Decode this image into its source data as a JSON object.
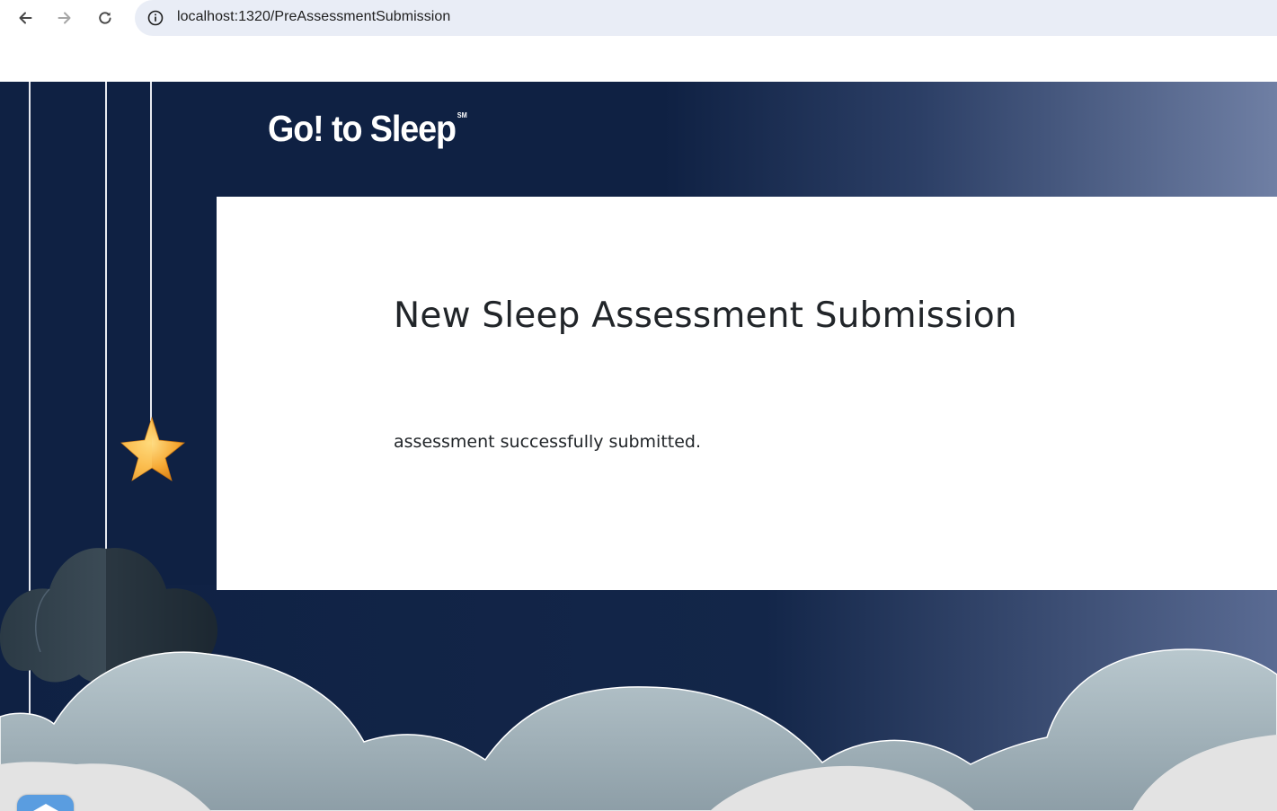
{
  "browser": {
    "url": "localhost:1320/PreAssessmentSubmission",
    "back_icon": "arrow-left-icon",
    "forward_icon": "arrow-right-icon",
    "reload_icon": "reload-icon",
    "site_info_icon": "info-icon"
  },
  "header": {
    "logo_text": "Go! to Sleep",
    "logo_mark": "SM"
  },
  "main": {
    "title": "New Sleep Assessment Submission",
    "message": "assessment successfully submitted."
  },
  "colors": {
    "page_background": "#0f2143",
    "card_background": "#ffffff",
    "text": "#212529",
    "star": "#f6a934",
    "cloud": "#b4c3c9"
  },
  "decorations": {
    "star_icon": "star-icon",
    "cloud_icon": "cloud-icon",
    "widget_icon": "chat-widget-icon"
  }
}
